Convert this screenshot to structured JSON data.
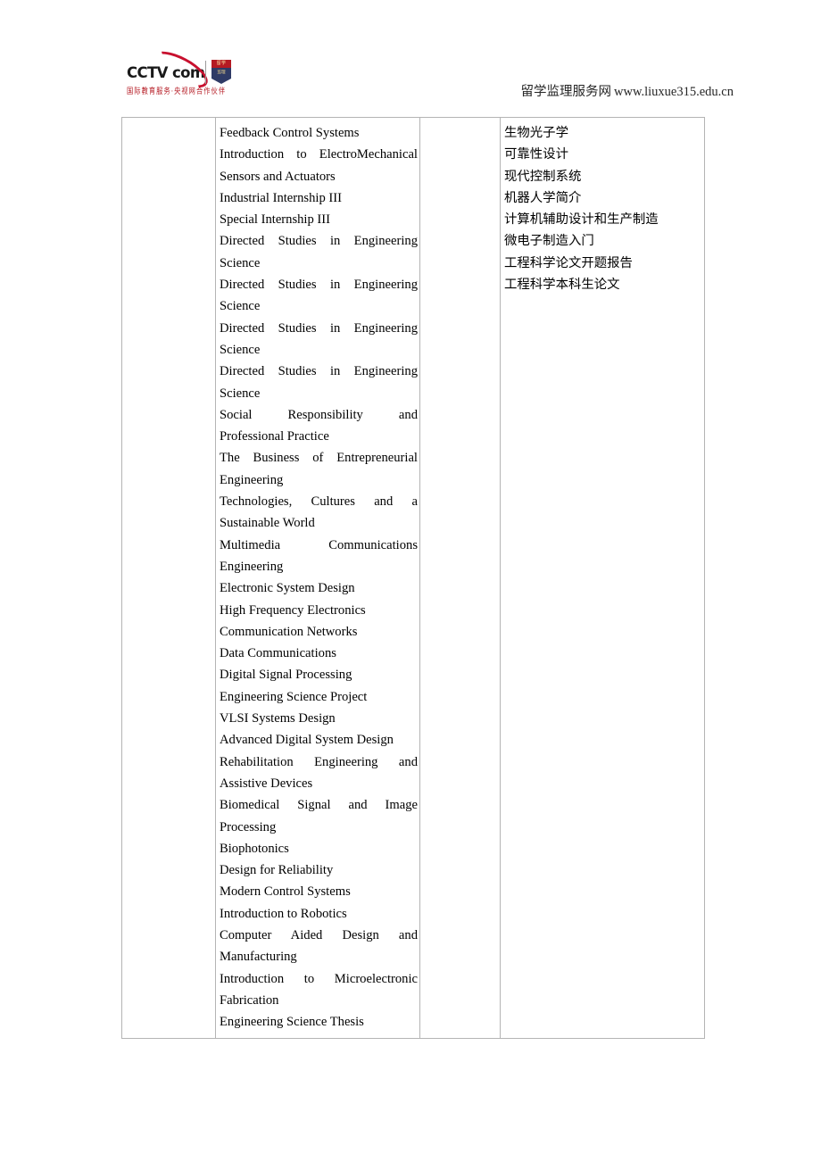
{
  "header": {
    "logo": {
      "wordmark": "CCTV     com",
      "badge_top_text": "留学",
      "badge_body_text": "监理",
      "tagline": "国际教育服务·央视网合作伙伴",
      "swoosh_color": "#c8102e",
      "badge_top_color": "#b51a23",
      "badge_body_color": "#2f3b66"
    },
    "watermark_cn": "留学监理服务网",
    "watermark_url": "www.liuxue315.edu.cn"
  },
  "table": {
    "columns": [
      {
        "name": "spacer-left",
        "content": ""
      },
      {
        "name": "english-courses",
        "content": "list"
      },
      {
        "name": "spacer-mid",
        "content": ""
      },
      {
        "name": "chinese-courses",
        "content": "list"
      }
    ],
    "english_courses": [
      "Feedback Control Systems",
      "Introduction to ElectroMechanical Sensors and Actuators",
      "Industrial Internship III",
      "Special Internship III",
      "Directed Studies in Engineering Science",
      "Directed Studies in Engineering Science",
      "Directed Studies in Engineering Science",
      "Directed Studies in Engineering Science",
      "Social Responsibility and Professional Practice",
      "The Business of Entrepreneurial Engineering",
      "Technologies, Cultures and a Sustainable World",
      "Multimedia Communications Engineering",
      "Electronic System Design",
      "High Frequency Electronics",
      "Communication Networks",
      "Data Communications",
      "Digital Signal Processing",
      "Engineering Science Project",
      "VLSI Systems Design",
      "Advanced Digital System Design",
      "Rehabilitation Engineering and Assistive Devices",
      "Biomedical Signal and Image Processing",
      "Biophotonics",
      "Design for Reliability",
      "Modern Control Systems",
      "Introduction to Robotics",
      "Computer Aided Design and Manufacturing",
      "Introduction to Microelectronic Fabrication",
      "Engineering Science Thesis"
    ],
    "chinese_courses": [
      "生物光子学",
      "可靠性设计",
      "现代控制系统",
      "机器人学简介",
      "计算机辅助设计和生产制造",
      "微电子制造入门",
      "工程科学论文开题报告",
      "工程科学本科生论文"
    ]
  }
}
